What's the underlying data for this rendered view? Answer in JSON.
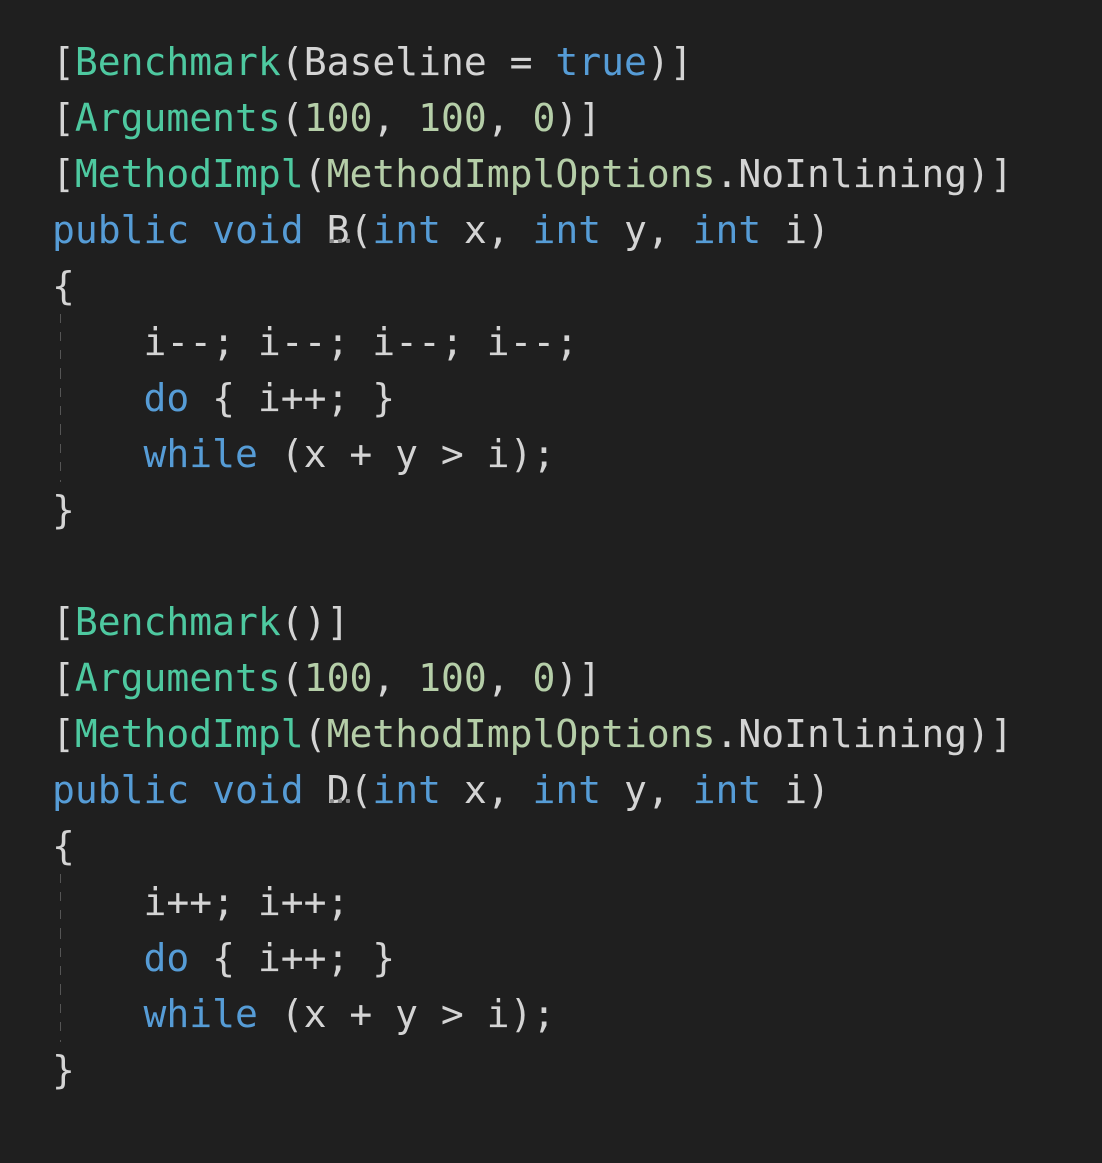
{
  "editor": {
    "language": "csharp",
    "theme": "dark",
    "background_color": "#1f1f1f",
    "colors": {
      "plain_text": "#d4d4d4",
      "attribute_name": "#4ec9a0",
      "keyword": "#569cd6",
      "number": "#b5cea8",
      "enum_type": "#b5cea8",
      "indent_guide": "#555555",
      "hint_dots": "#8a8a8a"
    },
    "lines": [
      {
        "id": "line-1",
        "indent_guide": false,
        "tokens": [
          {
            "text": "[",
            "kind": "plain"
          },
          {
            "text": "Benchmark",
            "kind": "attr"
          },
          {
            "text": "(",
            "kind": "plain"
          },
          {
            "text": "Baseline",
            "kind": "plain"
          },
          {
            "text": " = ",
            "kind": "op"
          },
          {
            "text": "true",
            "kind": "kw"
          },
          {
            "text": ")]",
            "kind": "plain"
          }
        ]
      },
      {
        "id": "line-2",
        "indent_guide": false,
        "tokens": [
          {
            "text": "[",
            "kind": "plain"
          },
          {
            "text": "Arguments",
            "kind": "attr"
          },
          {
            "text": "(",
            "kind": "plain"
          },
          {
            "text": "100",
            "kind": "num"
          },
          {
            "text": ", ",
            "kind": "plain"
          },
          {
            "text": "100",
            "kind": "num"
          },
          {
            "text": ", ",
            "kind": "plain"
          },
          {
            "text": "0",
            "kind": "num"
          },
          {
            "text": ")]",
            "kind": "plain"
          }
        ]
      },
      {
        "id": "line-3",
        "indent_guide": false,
        "tokens": [
          {
            "text": "[",
            "kind": "plain"
          },
          {
            "text": "MethodImpl",
            "kind": "attr"
          },
          {
            "text": "(",
            "kind": "plain"
          },
          {
            "text": "MethodImplOptions",
            "kind": "enum"
          },
          {
            "text": ".",
            "kind": "plain"
          },
          {
            "text": "NoInlining",
            "kind": "plain"
          },
          {
            "text": ")]",
            "kind": "plain"
          }
        ]
      },
      {
        "id": "line-4",
        "indent_guide": false,
        "tokens": [
          {
            "text": "public",
            "kind": "kw"
          },
          {
            "text": " ",
            "kind": "plain"
          },
          {
            "text": "void",
            "kind": "kw"
          },
          {
            "text": " ",
            "kind": "plain"
          },
          {
            "text": "B",
            "kind": "hint"
          },
          {
            "text": "(",
            "kind": "plain"
          },
          {
            "text": "int",
            "kind": "kw"
          },
          {
            "text": " x, ",
            "kind": "plain"
          },
          {
            "text": "int",
            "kind": "kw"
          },
          {
            "text": " y, ",
            "kind": "plain"
          },
          {
            "text": "int",
            "kind": "kw"
          },
          {
            "text": " i)",
            "kind": "plain"
          }
        ]
      },
      {
        "id": "line-5",
        "indent_guide": false,
        "tokens": [
          {
            "text": "{",
            "kind": "plain"
          }
        ]
      },
      {
        "id": "line-6",
        "indent_guide": true,
        "tokens": [
          {
            "text": "    i--; i--; i--; i--;",
            "kind": "plain"
          }
        ]
      },
      {
        "id": "line-7",
        "indent_guide": true,
        "tokens": [
          {
            "text": "    ",
            "kind": "plain"
          },
          {
            "text": "do",
            "kind": "kw"
          },
          {
            "text": " { i++; }",
            "kind": "plain"
          }
        ]
      },
      {
        "id": "line-8",
        "indent_guide": true,
        "tokens": [
          {
            "text": "    ",
            "kind": "plain"
          },
          {
            "text": "while",
            "kind": "kw"
          },
          {
            "text": " (x + y > i);",
            "kind": "plain"
          }
        ]
      },
      {
        "id": "line-9",
        "indent_guide": false,
        "tokens": [
          {
            "text": "}",
            "kind": "plain"
          }
        ]
      },
      {
        "id": "line-10",
        "indent_guide": false,
        "tokens": [
          {
            "text": "",
            "kind": "plain"
          }
        ]
      },
      {
        "id": "line-11",
        "indent_guide": false,
        "tokens": [
          {
            "text": "[",
            "kind": "plain"
          },
          {
            "text": "Benchmark",
            "kind": "attr"
          },
          {
            "text": "()]",
            "kind": "plain"
          }
        ]
      },
      {
        "id": "line-12",
        "indent_guide": false,
        "tokens": [
          {
            "text": "[",
            "kind": "plain"
          },
          {
            "text": "Arguments",
            "kind": "attr"
          },
          {
            "text": "(",
            "kind": "plain"
          },
          {
            "text": "100",
            "kind": "num"
          },
          {
            "text": ", ",
            "kind": "plain"
          },
          {
            "text": "100",
            "kind": "num"
          },
          {
            "text": ", ",
            "kind": "plain"
          },
          {
            "text": "0",
            "kind": "num"
          },
          {
            "text": ")]",
            "kind": "plain"
          }
        ]
      },
      {
        "id": "line-13",
        "indent_guide": false,
        "tokens": [
          {
            "text": "[",
            "kind": "plain"
          },
          {
            "text": "MethodImpl",
            "kind": "attr"
          },
          {
            "text": "(",
            "kind": "plain"
          },
          {
            "text": "MethodImplOptions",
            "kind": "enum"
          },
          {
            "text": ".",
            "kind": "plain"
          },
          {
            "text": "NoInlining",
            "kind": "plain"
          },
          {
            "text": ")]",
            "kind": "plain"
          }
        ]
      },
      {
        "id": "line-14",
        "indent_guide": false,
        "tokens": [
          {
            "text": "public",
            "kind": "kw"
          },
          {
            "text": " ",
            "kind": "plain"
          },
          {
            "text": "void",
            "kind": "kw"
          },
          {
            "text": " ",
            "kind": "plain"
          },
          {
            "text": "D",
            "kind": "hint"
          },
          {
            "text": "(",
            "kind": "plain"
          },
          {
            "text": "int",
            "kind": "kw"
          },
          {
            "text": " x, ",
            "kind": "plain"
          },
          {
            "text": "int",
            "kind": "kw"
          },
          {
            "text": " y, ",
            "kind": "plain"
          },
          {
            "text": "int",
            "kind": "kw"
          },
          {
            "text": " i)",
            "kind": "plain"
          }
        ]
      },
      {
        "id": "line-15",
        "indent_guide": false,
        "tokens": [
          {
            "text": "{",
            "kind": "plain"
          }
        ]
      },
      {
        "id": "line-16",
        "indent_guide": true,
        "tokens": [
          {
            "text": "    i++; i++;",
            "kind": "plain"
          }
        ]
      },
      {
        "id": "line-17",
        "indent_guide": true,
        "tokens": [
          {
            "text": "    ",
            "kind": "plain"
          },
          {
            "text": "do",
            "kind": "kw"
          },
          {
            "text": " { i++; }",
            "kind": "plain"
          }
        ]
      },
      {
        "id": "line-18",
        "indent_guide": true,
        "tokens": [
          {
            "text": "    ",
            "kind": "plain"
          },
          {
            "text": "while",
            "kind": "kw"
          },
          {
            "text": " (x + y > i);",
            "kind": "plain"
          }
        ]
      },
      {
        "id": "line-19",
        "indent_guide": false,
        "tokens": [
          {
            "text": "}",
            "kind": "plain"
          }
        ]
      }
    ]
  }
}
